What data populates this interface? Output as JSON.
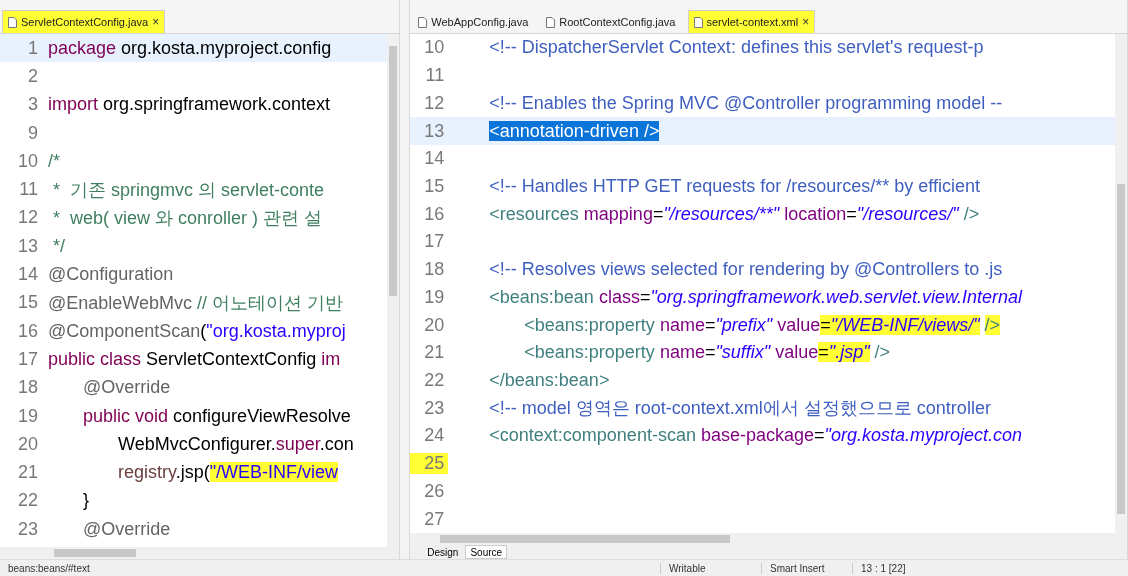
{
  "left_editor": {
    "tabs": [
      {
        "label": "ServletContextConfig.java",
        "selected": true,
        "highlight": true,
        "close": "×"
      }
    ],
    "lines": [
      {
        "number": "1",
        "current": true,
        "tokens": [
          {
            "text": "package",
            "kind": "keyword"
          },
          {
            "text": " org.kosta.myproject.config",
            "kind": "plain"
          }
        ]
      },
      {
        "number": "2",
        "current": false
      },
      {
        "number": "3",
        "current": false,
        "tokens": [
          {
            "text": "import",
            "kind": "keyword"
          },
          {
            "text": " org.springframework.context",
            "kind": "plain"
          }
        ]
      },
      {
        "number": "9",
        "current": false
      },
      {
        "number": "10",
        "current": false,
        "tokens": [
          {
            "text": "/*",
            "kind": "comment"
          }
        ]
      },
      {
        "number": "11",
        "current": false,
        "tokens": [
          {
            "text": " *  기존 springmvc 의 servlet-conte",
            "kind": "comment"
          }
        ]
      },
      {
        "number": "12",
        "current": false,
        "tokens": [
          {
            "text": " *  web( view 와 conroller ) 관련 설",
            "kind": "comment"
          }
        ]
      },
      {
        "number": "13",
        "current": false,
        "tokens": [
          {
            "text": " */",
            "kind": "comment"
          }
        ]
      },
      {
        "number": "14",
        "current": false,
        "tokens": [
          {
            "text": "@Configuration",
            "kind": "annotation"
          }
        ]
      },
      {
        "number": "15",
        "current": false,
        "tokens": [
          {
            "text": "@EnableWebMvc",
            "kind": "annotation"
          },
          {
            "text": " // 어노테이션 기반",
            "kind": "comment"
          }
        ]
      },
      {
        "number": "16",
        "current": false,
        "tokens": [
          {
            "text": "@ComponentScan",
            "kind": "annotation"
          },
          {
            "text": "(",
            "kind": "plain"
          },
          {
            "text": "\"org.kosta.myproj",
            "kind": "string"
          }
        ]
      },
      {
        "number": "17",
        "current": false,
        "tokens": [
          {
            "text": "public class",
            "kind": "keyword"
          },
          {
            "text": " ServletContextConfig ",
            "kind": "plain"
          },
          {
            "text": "im",
            "kind": "keyword"
          }
        ]
      },
      {
        "number": "18",
        "current": false,
        "tokens": [
          {
            "text": "\t@Override",
            "kind": "annotation"
          }
        ]
      },
      {
        "number": "19",
        "current": false,
        "tokens": [
          {
            "text": "\tpublic void",
            "kind": "keyword"
          },
          {
            "text": " configureViewResolve",
            "kind": "plain"
          }
        ]
      },
      {
        "number": "20",
        "current": false,
        "tokens": [
          {
            "text": "\t\tWebMvcConfigurer.",
            "kind": "plain"
          },
          {
            "text": "super",
            "kind": "keyword"
          },
          {
            "text": ".con",
            "kind": "plain"
          }
        ]
      },
      {
        "number": "21",
        "current": false,
        "tokens": [
          {
            "text": "\t\tregistry",
            "kind": "variable"
          },
          {
            "text": ".jsp(",
            "kind": "plain"
          },
          {
            "text": "\"/WEB-INF/view",
            "kind": "string",
            "highlight": true
          }
        ]
      },
      {
        "number": "22",
        "current": false,
        "tokens": [
          {
            "text": "\t}",
            "kind": "plain"
          }
        ]
      },
      {
        "number": "23",
        "current": false,
        "tokens": [
          {
            "text": "\t@Override",
            "kind": "annotation"
          }
        ]
      }
    ]
  },
  "right_editor": {
    "tabs": [
      {
        "label": "WebAppConfig.java",
        "selected": false,
        "highlight": false
      },
      {
        "label": "RootContextConfig.java",
        "selected": false,
        "highlight": false
      },
      {
        "label": "servlet-context.xml",
        "selected": true,
        "highlight": true,
        "close": "×"
      }
    ],
    "lines": [
      {
        "number": "10",
        "current": false,
        "tokens": [
          {
            "text": "\t<!-- DispatcherServlet Context: defines this servlet's request-p",
            "kind": "xml_comment"
          }
        ]
      },
      {
        "number": "11",
        "current": false
      },
      {
        "number": "12",
        "current": false,
        "tokens": [
          {
            "text": "\t<!-- Enables the Spring MVC @Controller programming model --",
            "kind": "xml_comment"
          }
        ]
      },
      {
        "number": "13",
        "current": true,
        "tokens": [
          {
            "text": "\t<annotation-driven />",
            "kind": "tag",
            "selected": true
          }
        ]
      },
      {
        "number": "14",
        "current": false
      },
      {
        "number": "15",
        "current": false,
        "tokens": [
          {
            "text": "\t<!-- Handles HTTP GET requests for /resources/** by efficient",
            "kind": "xml_comment"
          }
        ]
      },
      {
        "number": "16",
        "current": false,
        "tokens": [
          {
            "text": "\t<resources",
            "kind": "tag"
          },
          {
            "text": " mapping",
            "kind": "attr"
          },
          {
            "text": "=",
            "kind": "plain"
          },
          {
            "text": "\"/resources/**\"",
            "kind": "value"
          },
          {
            "text": " location",
            "kind": "attr"
          },
          {
            "text": "=",
            "kind": "plain"
          },
          {
            "text": "\"/resources/\"",
            "kind": "value"
          },
          {
            "text": " />",
            "kind": "tag"
          }
        ]
      },
      {
        "number": "17",
        "current": false
      },
      {
        "number": "18",
        "current": false,
        "tokens": [
          {
            "text": "\t<!-- Resolves views selected for rendering by @Controllers to .js",
            "kind": "xml_comment"
          }
        ]
      },
      {
        "number": "19",
        "current": false,
        "tokens": [
          {
            "text": "\t<beans:bean",
            "kind": "tag"
          },
          {
            "text": " class",
            "kind": "attr"
          },
          {
            "text": "=",
            "kind": "plain"
          },
          {
            "text": "\"org.springframework.web.servlet.view.Internal",
            "kind": "value"
          }
        ]
      },
      {
        "number": "20",
        "current": false,
        "tokens": [
          {
            "text": "\t\t<beans:property",
            "kind": "tag"
          },
          {
            "text": " name",
            "kind": "attr"
          },
          {
            "text": "=",
            "kind": "plain"
          },
          {
            "text": "\"prefix\"",
            "kind": "value"
          },
          {
            "text": " value",
            "kind": "attr"
          },
          {
            "text": "=",
            "kind": "plain",
            "highlight": true
          },
          {
            "text": "\"/WEB-INF/views/\"",
            "kind": "value",
            "highlight": true
          },
          {
            "text": " />",
            "kind": "tag",
            "highlight": true
          }
        ]
      },
      {
        "number": "21",
        "current": false,
        "tokens": [
          {
            "text": "\t\t<beans:property",
            "kind": "tag"
          },
          {
            "text": " name",
            "kind": "attr"
          },
          {
            "text": "=",
            "kind": "plain"
          },
          {
            "text": "\"suffix\"",
            "kind": "value"
          },
          {
            "text": " value",
            "kind": "attr"
          },
          {
            "text": "=",
            "kind": "plain",
            "highlight": true
          },
          {
            "text": "\".jsp\"",
            "kind": "value",
            "highlight": true
          },
          {
            "text": " />",
            "kind": "tag"
          }
        ]
      },
      {
        "number": "22",
        "current": false,
        "tokens": [
          {
            "text": "\t</beans:bean>",
            "kind": "tag"
          }
        ]
      },
      {
        "number": "23",
        "current": false,
        "tokens": [
          {
            "text": "\t<!-- model 영역은 root-context.xml에서 설정했으므로 controller",
            "kind": "xml_comment"
          }
        ]
      },
      {
        "number": "24",
        "current": false,
        "tokens": [
          {
            "text": "\t<context:component-scan",
            "kind": "tag"
          },
          {
            "text": " base-package",
            "kind": "attr"
          },
          {
            "text": "=",
            "kind": "plain"
          },
          {
            "text": "\"org.kosta.myproject.con",
            "kind": "value"
          }
        ]
      },
      {
        "number": "25",
        "current": false,
        "number_highlight": true
      },
      {
        "number": "26",
        "current": false
      },
      {
        "number": "27",
        "current": false
      }
    ],
    "bottom_tabs": [
      {
        "label": "Design",
        "selected": false
      },
      {
        "label": "Source",
        "selected": true
      }
    ]
  },
  "status_bar": {
    "path": "beans:beans/#text",
    "mode": "Writable",
    "insert": "Smart Insert",
    "position": "13 : 1 [22]"
  }
}
